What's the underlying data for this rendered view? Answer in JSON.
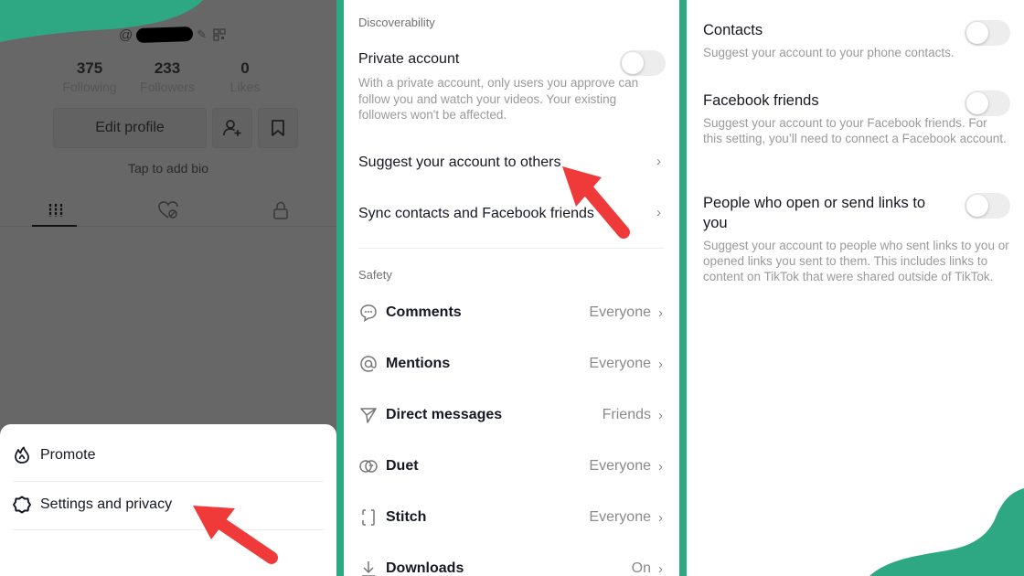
{
  "colors": {
    "accent_teal": "#2ea883",
    "arrow_red": "#f03a3a",
    "overlay_gray": "#676767"
  },
  "profile": {
    "handle_prefix": "@",
    "stats": [
      {
        "value": "375",
        "label": "Following"
      },
      {
        "value": "233",
        "label": "Followers"
      },
      {
        "value": "0",
        "label": "Likes"
      }
    ],
    "edit_profile_label": "Edit profile",
    "bio_placeholder": "Tap to add bio",
    "tabs": [
      "videos-grid",
      "liked",
      "private"
    ]
  },
  "menu_sheet": {
    "items": [
      {
        "icon": "flame-icon",
        "label": "Promote"
      },
      {
        "icon": "gear-icon",
        "label": "Settings and privacy"
      }
    ]
  },
  "privacy": {
    "discoverability_title": "Discoverability",
    "private_account": {
      "title": "Private account",
      "description": "With a private account, only users you approve can follow you and watch your videos. Your existing followers won't be affected.",
      "enabled": false
    },
    "suggest_label": "Suggest your account to others",
    "sync_label": "Sync contacts and Facebook friends",
    "safety_title": "Safety",
    "safety_items": [
      {
        "icon": "comment-icon",
        "label": "Comments",
        "value": "Everyone"
      },
      {
        "icon": "at-icon",
        "label": "Mentions",
        "value": "Everyone"
      },
      {
        "icon": "send-icon",
        "label": "Direct messages",
        "value": "Friends"
      },
      {
        "icon": "duet-icon",
        "label": "Duet",
        "value": "Everyone"
      },
      {
        "icon": "stitch-icon",
        "label": "Stitch",
        "value": "Everyone"
      },
      {
        "icon": "download-icon",
        "label": "Downloads",
        "value": "On"
      }
    ]
  },
  "suggest": {
    "items": [
      {
        "title": "Contacts",
        "description": "Suggest your account to your phone contacts.",
        "enabled": false
      },
      {
        "title": "Facebook friends",
        "description": "Suggest your account to your Facebook friends. For this setting, you’ll need to connect a Facebook account.",
        "enabled": false
      },
      {
        "title": "People who open or send links to you",
        "description": "Suggest your account to people who sent links to you or opened links you sent to them. This includes links to content on TikTok that were shared outside of TikTok.",
        "enabled": false
      }
    ]
  }
}
